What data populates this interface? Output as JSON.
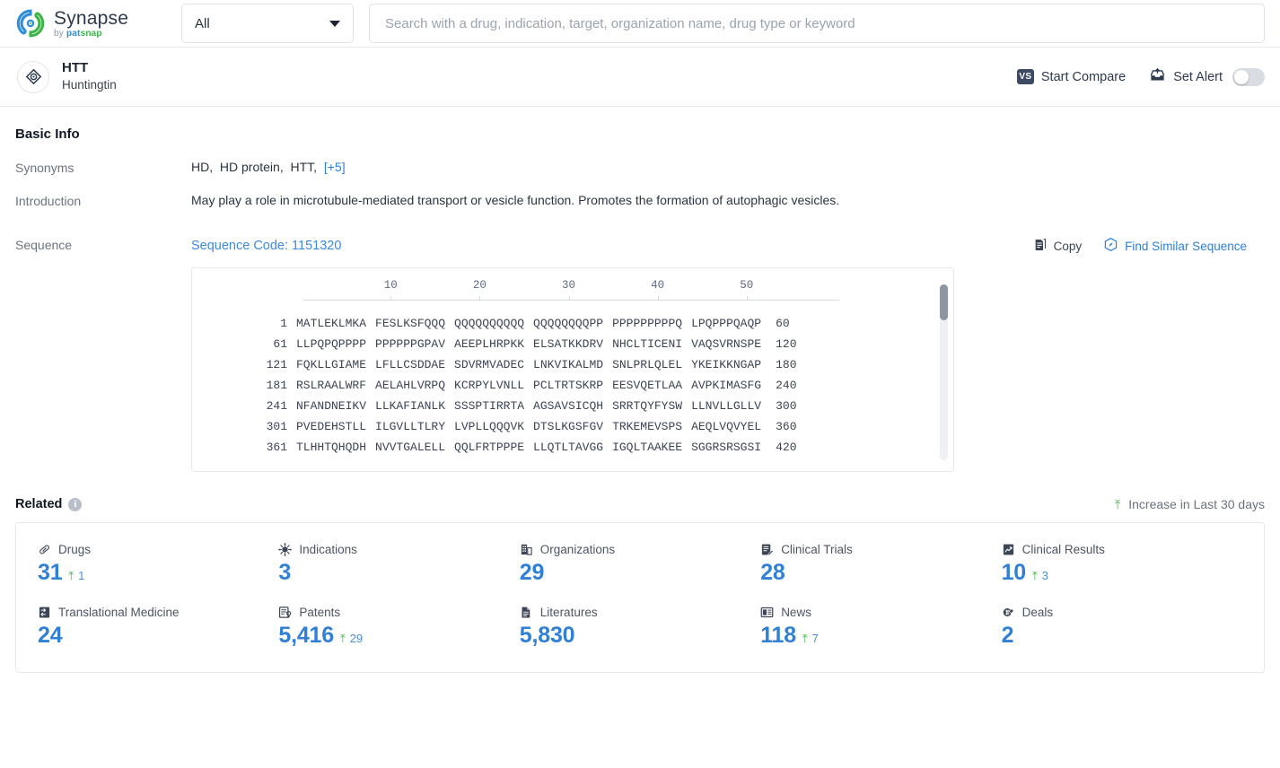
{
  "brand": {
    "name": "Synapse",
    "by": "by ",
    "pat": "pat",
    "snap": "snap",
    "logo_icon": "synapse-swirl-icon"
  },
  "search": {
    "scope_value": "All",
    "placeholder": "Search with a drug, indication, target, organization name, drug type or keyword",
    "value": "",
    "dropdown_icon": "chevron-down-icon"
  },
  "entity": {
    "icon": "target-diamond-icon",
    "name": "HTT",
    "subtitle": "Huntingtin",
    "compare_label": "Start Compare",
    "compare_icon": "vs-icon",
    "alert_label": "Set Alert",
    "alert_icon": "alert-inbox-icon",
    "alert_enabled": false
  },
  "basic_info": {
    "title": "Basic Info",
    "synonyms_label": "Synonyms",
    "synonyms": [
      "HD",
      "HD protein",
      "HTT"
    ],
    "synonyms_more": "[+5]",
    "introduction_label": "Introduction",
    "introduction": "May play a role in microtubule-mediated transport or vesicle function. Promotes the formation of autophagic vesicles.",
    "sequence_label": "Sequence",
    "sequence_code": "Sequence Code: 1151320",
    "copy_label": "Copy",
    "copy_icon": "copy-icon",
    "find_similar_label": "Find Similar Sequence",
    "find_similar_icon": "hexagon-compass-icon"
  },
  "sequence": {
    "ruler_ticks": [
      10,
      20,
      30,
      40,
      50
    ],
    "rows": [
      {
        "start": "1",
        "chunks": [
          "MATLEKLMKA",
          "FESLKSFQQQ",
          "QQQQQQQQQQ",
          "QQQQQQQQPP",
          "PPPPPPPPPQ",
          "LPQPPPQAQP"
        ],
        "end": "60"
      },
      {
        "start": "61",
        "chunks": [
          "LLPQPQPPPP",
          "PPPPPPGPAV",
          "AEEPLHRPKK",
          "ELSATKKDRV",
          "NHCLTICENI",
          "VAQSVRNSPE"
        ],
        "end": "120"
      },
      {
        "start": "121",
        "chunks": [
          "FQKLLGIAME",
          "LFLLCSDDAE",
          "SDVRMVADEC",
          "LNKVIKALMD",
          "SNLPRLQLEL",
          "YKEIKKNGAP"
        ],
        "end": "180"
      },
      {
        "start": "181",
        "chunks": [
          "RSLRAALWRF",
          "AELAHLVRPQ",
          "KCRPYLVNLL",
          "PCLTRTSKRP",
          "EESVQETLAA",
          "AVPKIMASFG"
        ],
        "end": "240"
      },
      {
        "start": "241",
        "chunks": [
          "NFANDNEIKV",
          "LLKAFIANLK",
          "SSSPTIRRTA",
          "AGSAVSICQH",
          "SRRTQYFYSW",
          "LLNVLLGLLV"
        ],
        "end": "300"
      },
      {
        "start": "301",
        "chunks": [
          "PVEDEHSTLL",
          "ILGVLLTLRY",
          "LVPLLQQQVK",
          "DTSLKGSFGV",
          "TRKEMEVSPS",
          "AEQLVQVYEL"
        ],
        "end": "360"
      },
      {
        "start": "361",
        "chunks": [
          "TLHHTQHQDH",
          "NVVTGALELL",
          "QQLFRTPPPE",
          "LLQTLTAVGG",
          "IGQLTAAKEE",
          "SGGRSRSGSI"
        ],
        "end": "420"
      }
    ]
  },
  "related": {
    "title": "Related",
    "info_icon": "info-icon",
    "legend_icon": "arrow-up-icon",
    "legend_label": "Increase in Last 30 days",
    "stats": [
      {
        "icon": "pill-icon",
        "label": "Drugs",
        "value": "31",
        "delta": "1"
      },
      {
        "icon": "virus-icon",
        "label": "Indications",
        "value": "3",
        "delta": ""
      },
      {
        "icon": "building-icon",
        "label": "Organizations",
        "value": "29",
        "delta": ""
      },
      {
        "icon": "trial-icon",
        "label": "Clinical Trials",
        "value": "28",
        "delta": ""
      },
      {
        "icon": "results-icon",
        "label": "Clinical Results",
        "value": "10",
        "delta": "3"
      },
      {
        "icon": "translation-icon",
        "label": "Translational Medicine",
        "value": "24",
        "delta": ""
      },
      {
        "icon": "patent-icon",
        "label": "Patents",
        "value": "5,416",
        "delta": "29"
      },
      {
        "icon": "literature-icon",
        "label": "Literatures",
        "value": "5,830",
        "delta": ""
      },
      {
        "icon": "news-icon",
        "label": "News",
        "value": "118",
        "delta": "7"
      },
      {
        "icon": "deal-icon",
        "label": "Deals",
        "value": "2",
        "delta": ""
      }
    ]
  },
  "colors": {
    "accent_blue": "#2f80d6",
    "green": "#3cb44a",
    "text_dark": "#1b2430",
    "muted": "#6b7380"
  }
}
